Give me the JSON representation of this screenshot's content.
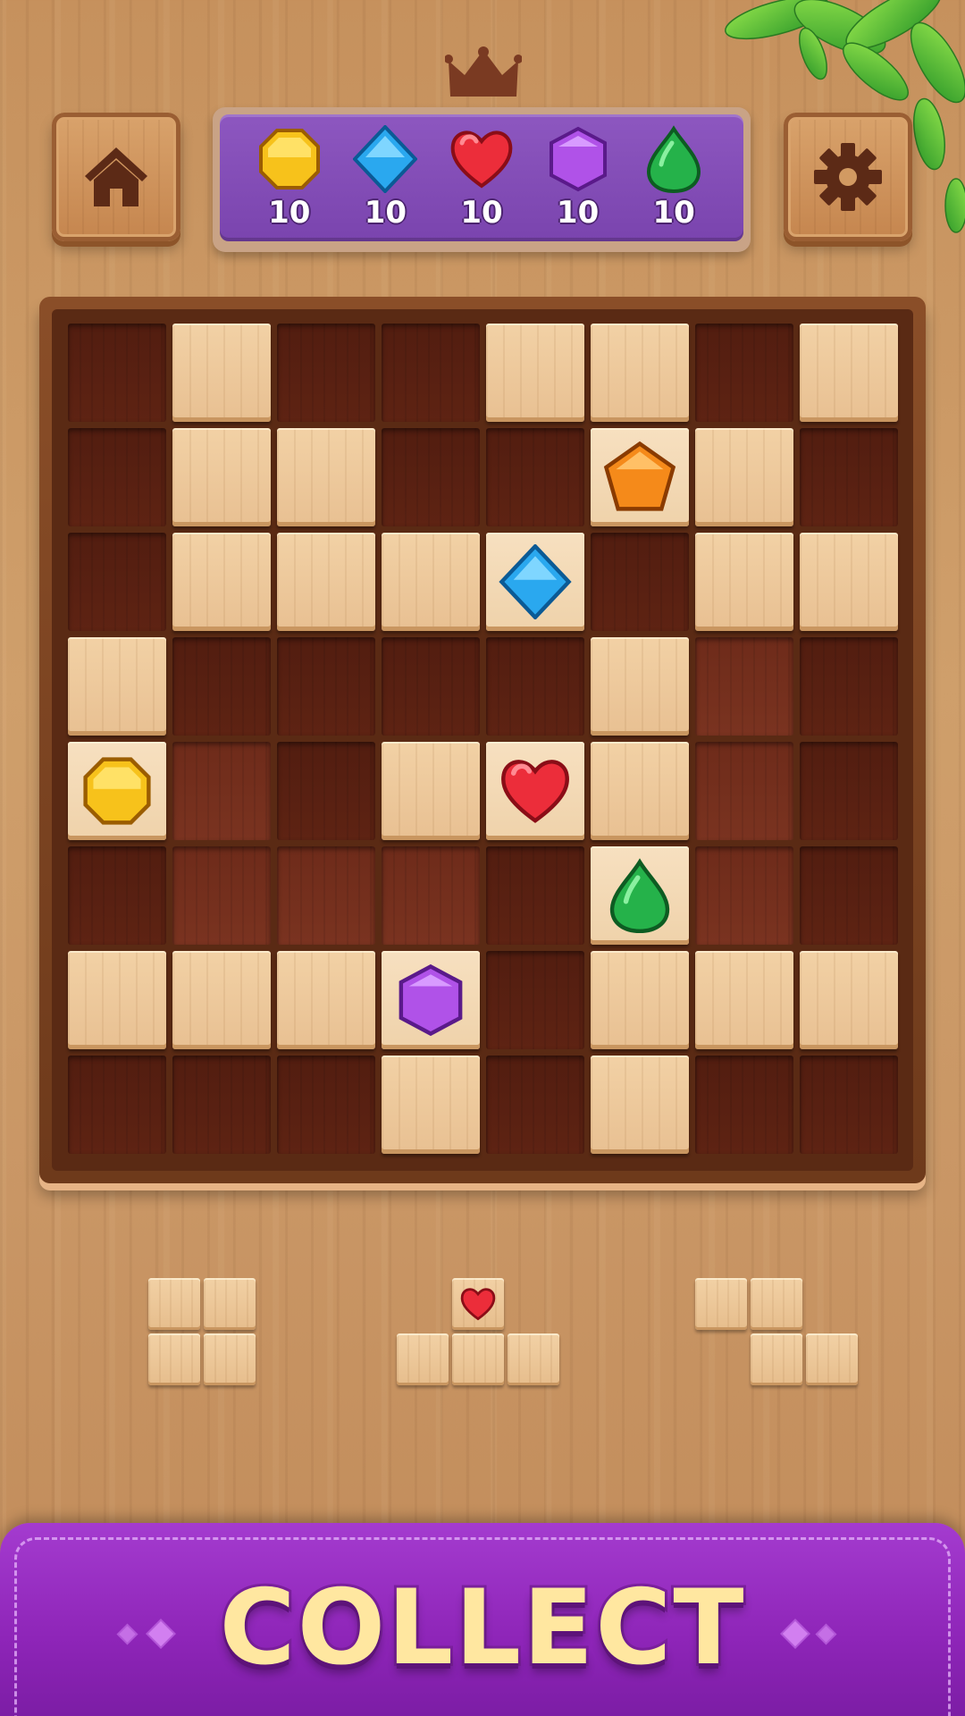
{
  "header": {
    "home_icon": "home-icon",
    "settings_icon": "gear-icon",
    "crown_icon": "crown-icon"
  },
  "goals": [
    {
      "gem": "yellow-octagon",
      "color": "#f7c21b",
      "count": "10"
    },
    {
      "gem": "blue-diamond",
      "color": "#2aa8ef",
      "count": "10"
    },
    {
      "gem": "red-heart",
      "color": "#ec2d3a",
      "count": "10"
    },
    {
      "gem": "purple-hexagon",
      "color": "#b052e8",
      "count": "10"
    },
    {
      "gem": "green-drop",
      "color": "#25b24a",
      "count": "10"
    }
  ],
  "board": {
    "rows": [
      [
        "empty",
        "block",
        "empty",
        "empty",
        "block",
        "block",
        "empty",
        "block"
      ],
      [
        "empty",
        "block",
        "block",
        "empty",
        "empty",
        "gem:orange-pentagon",
        "block",
        "empty"
      ],
      [
        "empty",
        "block",
        "block",
        "block",
        "gem:blue-diamond",
        "empty",
        "block",
        "block"
      ],
      [
        "block",
        "empty",
        "empty",
        "empty",
        "empty",
        "block",
        "empty-light",
        "empty"
      ],
      [
        "gem:yellow-octagon",
        "empty-light",
        "empty",
        "block",
        "gem:red-heart",
        "block",
        "empty-light",
        "empty"
      ],
      [
        "empty",
        "empty-light",
        "empty-light",
        "empty-light",
        "empty",
        "gem:green-drop",
        "empty-light",
        "empty"
      ],
      [
        "block",
        "block",
        "block",
        "gem:purple-hexagon",
        "empty",
        "block",
        "block",
        "block"
      ],
      [
        "empty",
        "empty",
        "empty",
        "block",
        "empty",
        "block",
        "empty",
        "empty"
      ]
    ]
  },
  "pieces": [
    {
      "shape": "square-2x2"
    },
    {
      "shape": "t-shape",
      "gem": "red-heart"
    },
    {
      "shape": "z-shape"
    }
  ],
  "banner": {
    "title": "COLLECT"
  }
}
